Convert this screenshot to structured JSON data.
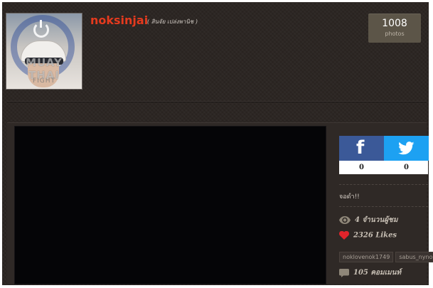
{
  "profile": {
    "username": "noksinjai",
    "fullname": "( สินจัย เปล่งพานิช )",
    "avatar_icon": "user-photo-icon",
    "watermark_text": "MUAY THAI",
    "watermark_sub": "FIGHT"
  },
  "photos": {
    "count": "1008",
    "label": "photos"
  },
  "share": {
    "facebook": {
      "icon": "facebook-icon",
      "glyph": "f",
      "count": "0",
      "color": "#3b5998"
    },
    "twitter": {
      "icon": "twitter-icon",
      "count": "0",
      "color": "#1da1f2"
    }
  },
  "post": {
    "title": "จอดำ!!"
  },
  "stats": {
    "views": {
      "icon": "eye-icon",
      "text": "4 จำนวนผู้ชม"
    },
    "likes": {
      "icon": "heart-icon",
      "text": "2326 Likes",
      "color": "#e0242b"
    },
    "comments": {
      "icon": "comment-icon",
      "text": "105 คอมเมนท์"
    }
  },
  "tags": [
    "noklovenok1749",
    "sabus_nynoo"
  ],
  "colors": {
    "accent": "#e43a1e",
    "background": "#2b2522",
    "badge": "#5c5548"
  }
}
